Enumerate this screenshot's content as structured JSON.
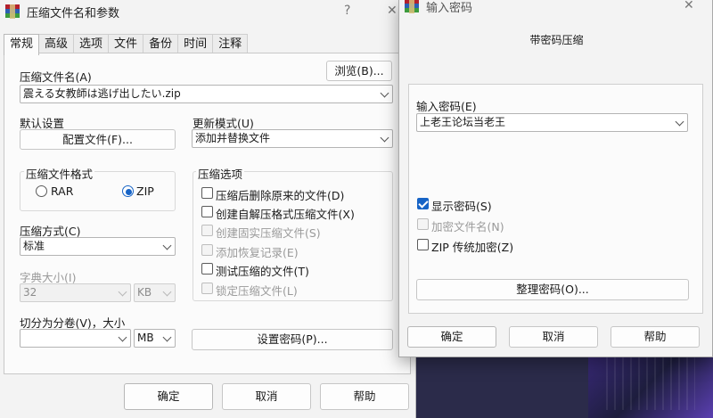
{
  "main_dialog": {
    "title": "压缩文件名和参数",
    "help_glyph": "?",
    "close_glyph": "✕",
    "tabs": [
      "常规",
      "高级",
      "选项",
      "文件",
      "备份",
      "时间",
      "注释"
    ],
    "archive_name_label": "压缩文件名(A)",
    "archive_name_value": "震える女教師は逃げ出したい.zip",
    "browse_button": "浏览(B)...",
    "default_settings_label": "默认设置",
    "profiles_button": "配置文件(F)...",
    "update_mode_label": "更新模式(U)",
    "update_mode_value": "添加并替换文件",
    "format_group_label": "压缩文件格式",
    "format_options": [
      {
        "label": "RAR",
        "selected": false
      },
      {
        "label": "ZIP",
        "selected": true
      }
    ],
    "options_group_label": "压缩选项",
    "options": [
      {
        "label": "压缩后删除原来的文件(D)",
        "checked": false,
        "disabled": false
      },
      {
        "label": "创建自解压格式压缩文件(X)",
        "checked": false,
        "disabled": false
      },
      {
        "label": "创建固实压缩文件(S)",
        "checked": false,
        "disabled": true
      },
      {
        "label": "添加恢复记录(E)",
        "checked": false,
        "disabled": true
      },
      {
        "label": "测试压缩的文件(T)",
        "checked": false,
        "disabled": false
      },
      {
        "label": "锁定压缩文件(L)",
        "checked": false,
        "disabled": true
      }
    ],
    "method_label": "压缩方式(C)",
    "method_value": "标准",
    "dict_label": "字典大小(I)",
    "dict_value": "32",
    "dict_unit": "KB",
    "split_label": "切分为分卷(V)，大小",
    "split_value": "",
    "split_unit": "MB",
    "set_password_button": "设置密码(P)...",
    "ok_button": "确定",
    "cancel_button": "取消",
    "help_button": "帮助"
  },
  "password_dialog": {
    "title": "输入密码",
    "close_glyph": "✕",
    "heading": "带密码压缩",
    "password_label": "输入密码(E)",
    "password_value": "上老王论坛当老王",
    "checkboxes": [
      {
        "label": "显示密码(S)",
        "checked": true,
        "disabled": false
      },
      {
        "label": "加密文件名(N)",
        "checked": false,
        "disabled": true
      },
      {
        "label": "ZIP 传统加密(Z)",
        "checked": false,
        "disabled": false
      }
    ],
    "organize_button": "整理密码(O)...",
    "ok_button": "确定",
    "cancel_button": "取消",
    "help_button": "帮助"
  },
  "colors": {
    "accent": "#1764c6",
    "dialog_bg": "#f3f3f3",
    "panel_bg": "#fbfbfb"
  }
}
